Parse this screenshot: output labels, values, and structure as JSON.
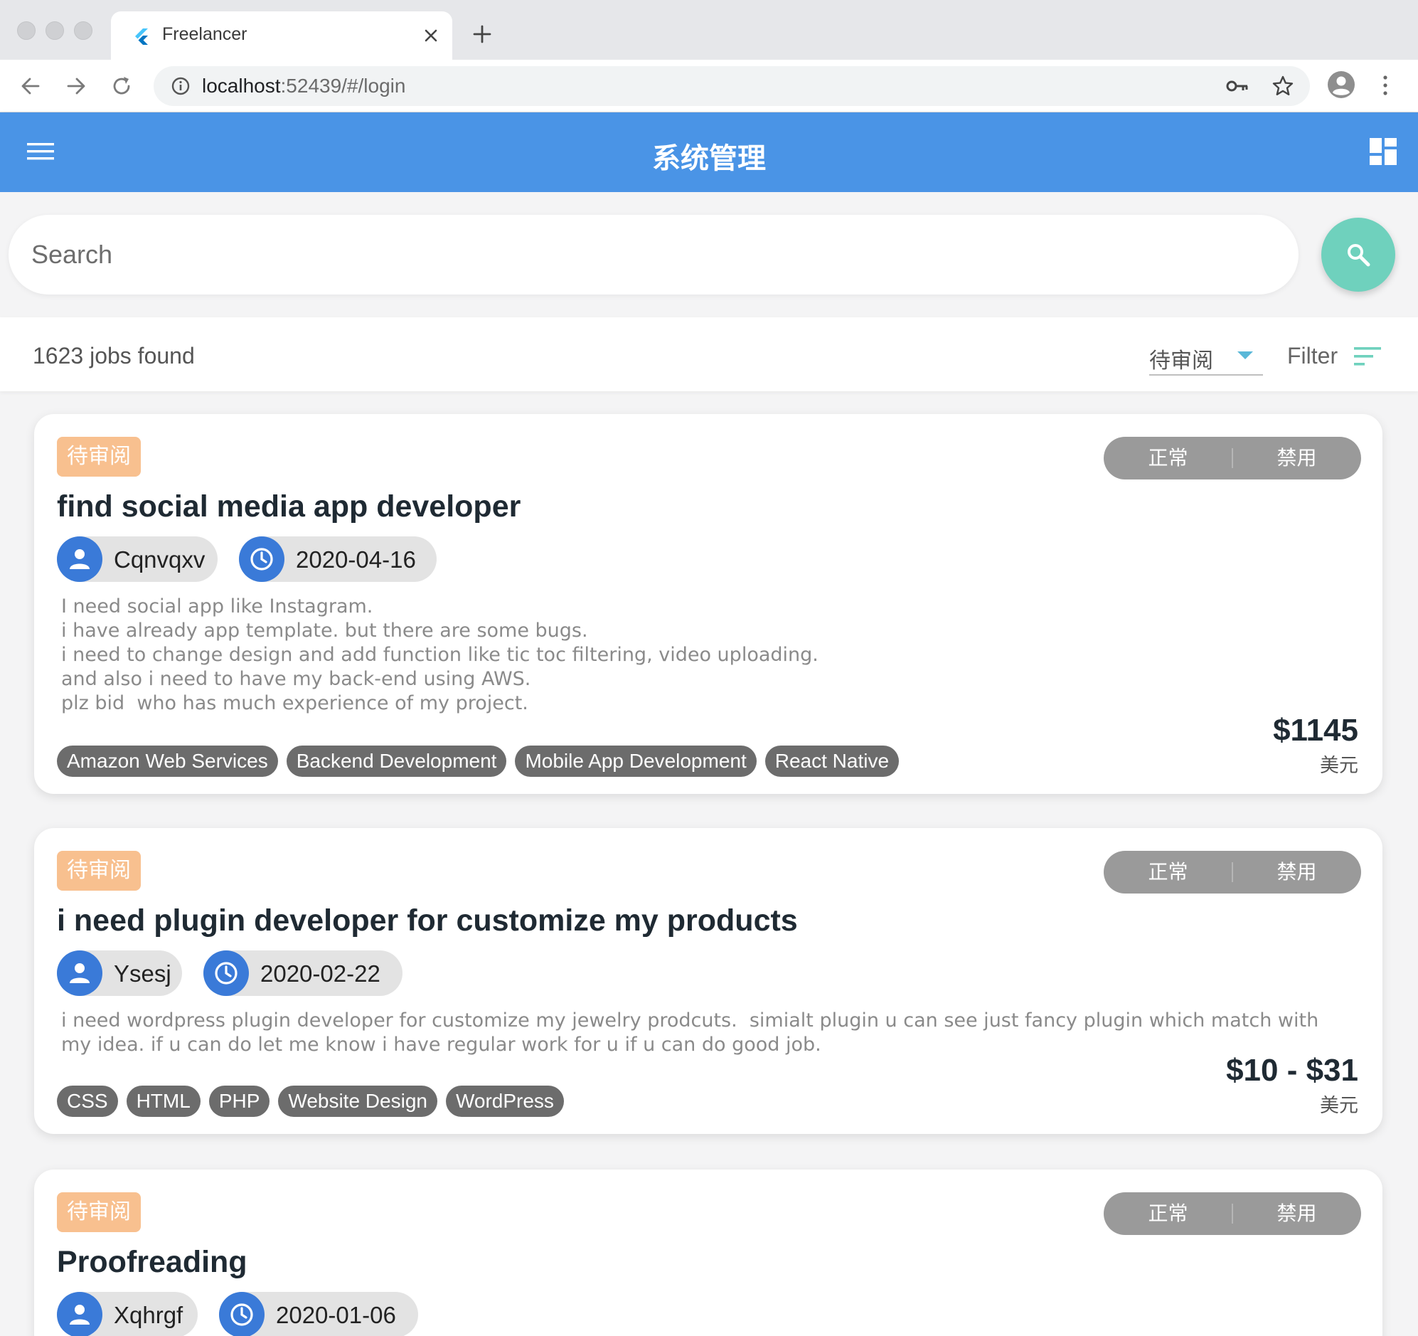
{
  "browser": {
    "tab_title": "Freelancer",
    "url_host": "localhost",
    "url_rest": ":52439/#/login"
  },
  "appbar": {
    "title": "系统管理"
  },
  "search": {
    "placeholder": "Search"
  },
  "results": {
    "count_text": "1623 jobs found",
    "status_value": "待审阅",
    "filter_label": "Filter"
  },
  "jobs": [
    {
      "badge": "待审阅",
      "toggle_on": "正常",
      "toggle_off": "禁用",
      "title": "find social media app developer",
      "user": "Cqnvqxv",
      "date": "2020-04-16",
      "description": "I need social app like Instagram.\ni have already app template. but there are some bugs.\ni need to change design and add function like tic toc filtering, video uploading.\nand also i need to have my back-end using AWS.\nplz bid  who has much experience of my project.",
      "tags": [
        "Amazon Web Services",
        "Backend Development",
        "Mobile App Development",
        "React Native"
      ],
      "price": "$1145",
      "currency": "美元"
    },
    {
      "badge": "待审阅",
      "toggle_on": "正常",
      "toggle_off": "禁用",
      "title": "i need plugin developer for customize my products",
      "user": "Ysesj",
      "date": "2020-02-22",
      "description": "i need wordpress plugin developer for customize my jewelry prodcuts.  simialt plugin u can see just fancy plugin which match with\nmy idea. if u can do let me know i have regular work for u if u can do good job.",
      "tags": [
        "CSS",
        "HTML",
        "PHP",
        "Website Design",
        "WordPress"
      ],
      "price": "$10 - $31",
      "currency": "美元"
    },
    {
      "badge": "待审阅",
      "toggle_on": "正常",
      "toggle_off": "禁用",
      "title": "Proofreading",
      "user": "Xqhrgf",
      "date": "2020-01-06"
    }
  ],
  "icons": {
    "brand_color": "#4a94e6",
    "fab_color": "#6fd1bd",
    "badge_color": "#f8c08f"
  }
}
